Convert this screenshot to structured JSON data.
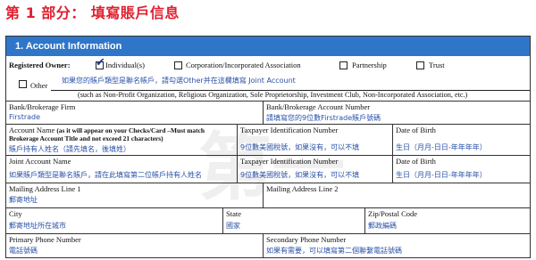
{
  "page_title": "第 1 部分： 填寫賬戶信息",
  "section": {
    "title": "1. Account Information"
  },
  "registered_owner": {
    "label": "Registered Owner:",
    "options": [
      {
        "label": "Individual(s)",
        "checked": true
      },
      {
        "label": "Corporation/Incorporated Association",
        "checked": false
      },
      {
        "label": "Partnership",
        "checked": false
      },
      {
        "label": "Trust",
        "checked": false
      },
      {
        "label": "Other",
        "checked": false
      }
    ],
    "other_hint": "如果您的賬戶類型是聯名帳戶，請勾選Other并在這欄填寫 Joint Account",
    "other_note": "(such as Non-Profit Organization, Religious Organization, Sole Proprietorship, Investment Club, Non-Incorporated Association, etc.)"
  },
  "fields": {
    "bank_firm": {
      "label": "Bank/Brokerage Firm",
      "value": "Firstrade"
    },
    "bank_account": {
      "label": "Bank/Brokerage Account Number",
      "hint": "請填寫您的9位數Firstrade賬戶號碼"
    },
    "account_name": {
      "label": "Account Name",
      "label_note": "(as it will appear on your Checks/Card –Must match",
      "label_note_2": "Brokerage Account Title and not exceed 21 characters)",
      "hint": "賬戶持有人姓名（請先填名，後填姓）"
    },
    "tax_id_1": {
      "label": "Taxpayer Identification Number",
      "hint": "9位數美國稅號，如果沒有，可以不填"
    },
    "dob_1": {
      "label": "Date of Birth",
      "hint": "生日（月月-日日-年年年年）"
    },
    "joint_name": {
      "label": "Joint Account Name",
      "hint": "如果賬戶類型是聯名賬戶，請在此填寫第二位帳戶持有人姓名"
    },
    "tax_id_2": {
      "label": "Taxpayer Identification Number",
      "hint": "9位數美國稅號，如果沒有，可以不填"
    },
    "dob_2": {
      "label": "Date of Birth",
      "hint": "生日（月月-日日-年年年年）"
    },
    "mailing_1": {
      "label": "Mailing Address Line 1",
      "hint": "郵寄地址"
    },
    "mailing_2": {
      "label": "Mailing Address Line 2"
    },
    "city": {
      "label": "City",
      "hint": "郵寄地址所在城市"
    },
    "state": {
      "label": "State",
      "hint": "國家"
    },
    "zip": {
      "label": "Zip/Postal Code",
      "hint": "郵政編碼"
    },
    "primary_phone": {
      "label": "Primary Phone Number",
      "hint": "電話號碼"
    },
    "secondary_phone": {
      "label": "Secondary Phone Number",
      "hint": "如果有需要，可以填寫第二個聯繫電話號碼"
    }
  },
  "watermark": "第一"
}
